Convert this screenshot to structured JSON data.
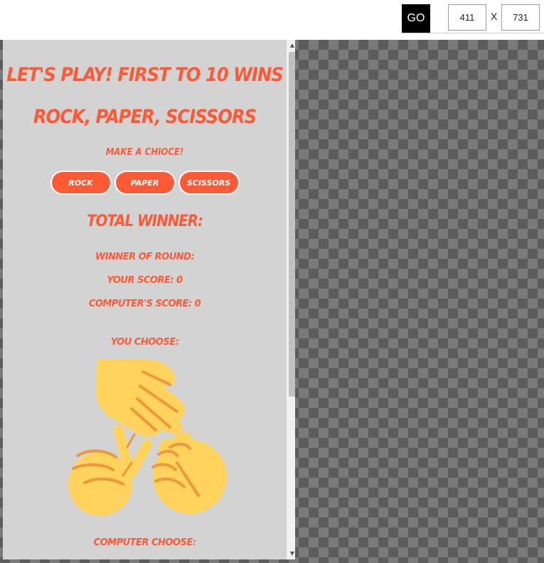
{
  "toolbar": {
    "go_label": "GO",
    "width_value": "411",
    "height_value": "731",
    "x_separator": "X"
  },
  "game": {
    "main_heading": "Let's Play! First to 10 wins",
    "title": "Rock, Paper, Scissors",
    "make_choice": "Make a chioce!",
    "buttons": [
      "Rock",
      "Paper",
      "Scissors"
    ],
    "total_winner": "Total Winner:",
    "round_winner": "Winner of Round:",
    "your_score": "Your score: 0",
    "computer_score": "Computer's score: 0",
    "you_choose": "You choose:",
    "computer_choose": "Computer choose:"
  },
  "colors": {
    "accent": "#ff5a36",
    "panel": "#d3d3d3",
    "hand_fill": "#ffd35c",
    "hand_line": "#f0963c"
  },
  "icons": [
    "rock-paper-scissors-hands-icon"
  ]
}
